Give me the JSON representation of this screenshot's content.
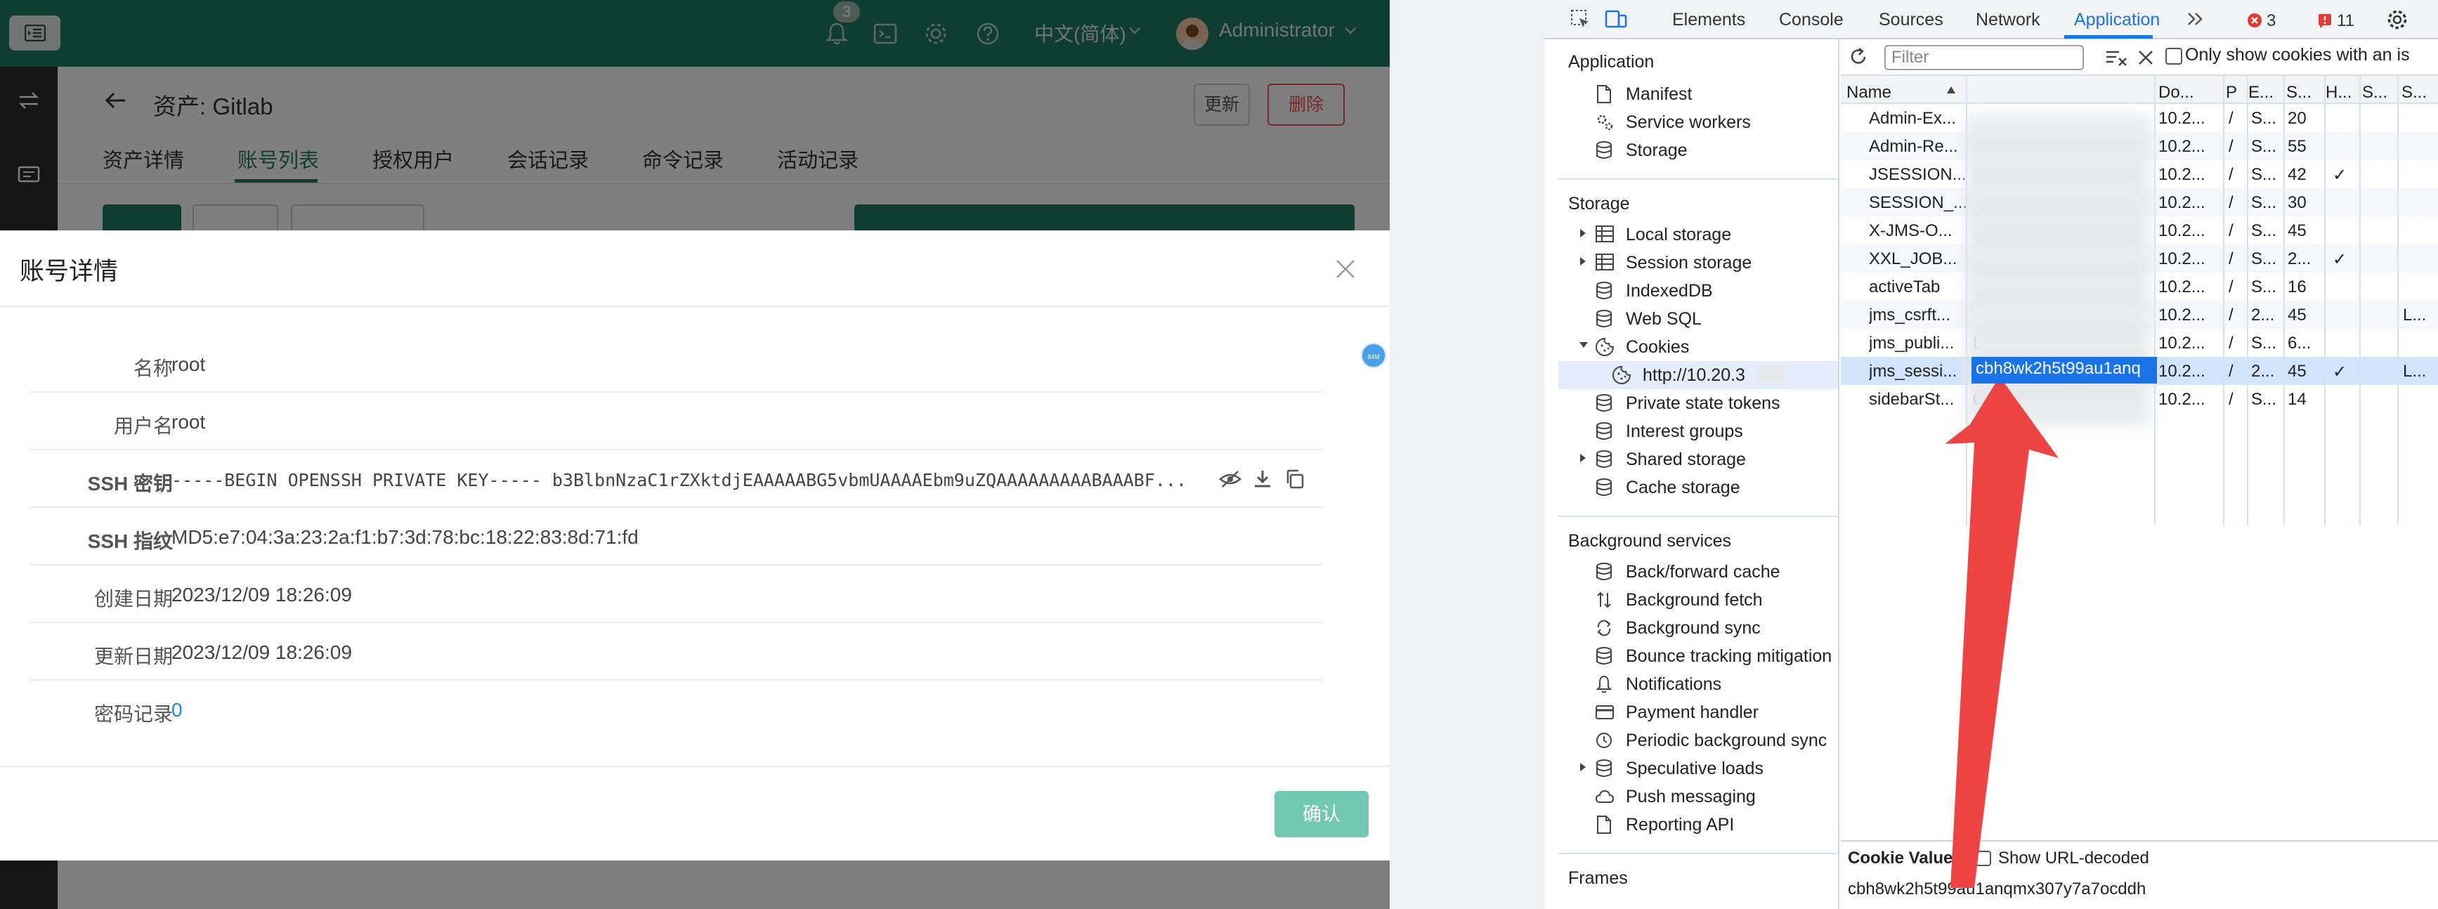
{
  "topbar": {
    "notification_count": "3",
    "language": "中文(简体)",
    "user_name": "Administrator"
  },
  "page": {
    "asset_title": "资产: Gitlab",
    "update_label": "更新",
    "delete_label": "删除",
    "tabs": [
      {
        "label": "资产详情",
        "active": false
      },
      {
        "label": "账号列表",
        "active": true
      },
      {
        "label": "授权用户",
        "active": false
      },
      {
        "label": "会话记录",
        "active": false
      },
      {
        "label": "命令记录",
        "active": false
      },
      {
        "label": "活动记录",
        "active": false
      }
    ]
  },
  "modal": {
    "title": "账号详情",
    "rows": [
      {
        "label": "名称",
        "value": "root"
      },
      {
        "label": "用户名",
        "value": "root"
      },
      {
        "label": "SSH 密钥",
        "value": "-----BEGIN OPENSSH PRIVATE KEY----- b3BlbnNzaC1rZXktdjEAAAAABG5vbmUAAAAEbm9uZQAAAAAAAAABAAABF..."
      },
      {
        "label": "SSH 指纹",
        "value": "MD5:e7:04:3a:23:2a:f1:b7:3d:78:bc:18:22:83:8d:71:fd"
      },
      {
        "label": "创建日期",
        "value": "2023/12/09 18:26:09"
      },
      {
        "label": "更新日期",
        "value": "2023/12/09 18:26:09"
      },
      {
        "label": "密码记录",
        "value": "0"
      }
    ],
    "confirm_label": "确认",
    "small_badge": "84M"
  },
  "devtools": {
    "tabs": [
      "Elements",
      "Console",
      "Sources",
      "Network",
      "Application"
    ],
    "active_tab": "Application",
    "error_count": "3",
    "warning_count": "11",
    "filter_placeholder": "Filter",
    "only_issues_label": "Only show cookies with an is",
    "sidebar": {
      "application_heading": "Application",
      "application_items": [
        "Manifest",
        "Service workers",
        "Storage"
      ],
      "storage_heading": "Storage",
      "storage_items": [
        "Local storage",
        "Session storage",
        "IndexedDB",
        "Web SQL",
        "Cookies",
        "http://10.20.3",
        "Private state tokens",
        "Interest groups",
        "Shared storage",
        "Cache storage"
      ],
      "background_heading": "Background services",
      "background_items": [
        "Back/forward cache",
        "Background fetch",
        "Background sync",
        "Bounce tracking mitigation",
        "Notifications",
        "Payment handler",
        "Periodic background sync",
        "Speculative loads",
        "Push messaging",
        "Reporting API"
      ],
      "frames_heading": "Frames"
    },
    "table": {
      "headers": [
        "Name",
        "Do...",
        "P",
        "E...",
        "S...",
        "H...",
        "S...",
        "S..."
      ],
      "rows": [
        {
          "name": "Admin-Ex...",
          "value": "",
          "domain": "10.2...",
          "path": "/",
          "expires": "S...",
          "size": "20",
          "httponly": "",
          "secure": "",
          "samesite": ""
        },
        {
          "name": "Admin-Re...",
          "value": "",
          "domain": "10.2...",
          "path": "/",
          "expires": "S...",
          "size": "55",
          "httponly": "",
          "secure": "",
          "samesite": ""
        },
        {
          "name": "JSESSION...",
          "value": "",
          "domain": "10.2...",
          "path": "/",
          "expires": "S...",
          "size": "42",
          "httponly": "✓",
          "secure": "",
          "samesite": ""
        },
        {
          "name": "SESSION_...",
          "value": "",
          "domain": "10.2...",
          "path": "/",
          "expires": "S...",
          "size": "30",
          "httponly": "",
          "secure": "",
          "samesite": ""
        },
        {
          "name": "X-JMS-O...",
          "value": "",
          "domain": "10.2...",
          "path": "/",
          "expires": "S...",
          "size": "45",
          "httponly": "",
          "secure": "",
          "samesite": ""
        },
        {
          "name": "XXL_JOB...",
          "value": "",
          "domain": "10.2...",
          "path": "/",
          "expires": "S...",
          "size": "2...",
          "httponly": "✓",
          "secure": "",
          "samesite": ""
        },
        {
          "name": "activeTab",
          "value": "",
          "domain": "10.2...",
          "path": "/",
          "expires": "S...",
          "size": "16",
          "httponly": "",
          "secure": "",
          "samesite": ""
        },
        {
          "name": "jms_csrft...",
          "value": "",
          "domain": "10.2...",
          "path": "/",
          "expires": "2...",
          "size": "45",
          "httponly": "",
          "secure": "",
          "samesite": "L..."
        },
        {
          "name": "jms_publi...",
          "value": "L",
          "domain": "10.2...",
          "path": "/",
          "expires": "S...",
          "size": "6...",
          "httponly": "",
          "secure": "",
          "samesite": ""
        },
        {
          "name": "jms_sessi...",
          "value": "cbh8wk2h5t99au1anq",
          "domain": "10.2...",
          "path": "/",
          "expires": "2...",
          "size": "45",
          "httponly": "✓",
          "secure": "",
          "samesite": "L..."
        },
        {
          "name": "sidebarSt...",
          "value": "0",
          "domain": "10.2...",
          "path": "/",
          "expires": "S...",
          "size": "14",
          "httponly": "",
          "secure": "",
          "samesite": ""
        }
      ]
    },
    "cookie_value": {
      "title": "Cookie Value",
      "checkbox_label": "Show URL-decoded",
      "value": "cbh8wk2h5t99au1anqmx307y7a7ocddh"
    }
  },
  "colors": {
    "brand": "#1e7b62",
    "danger": "#ee5050",
    "confirm": "#71c8b3",
    "devtools_accent": "#1a73e8",
    "arrow": "#ef4444"
  }
}
